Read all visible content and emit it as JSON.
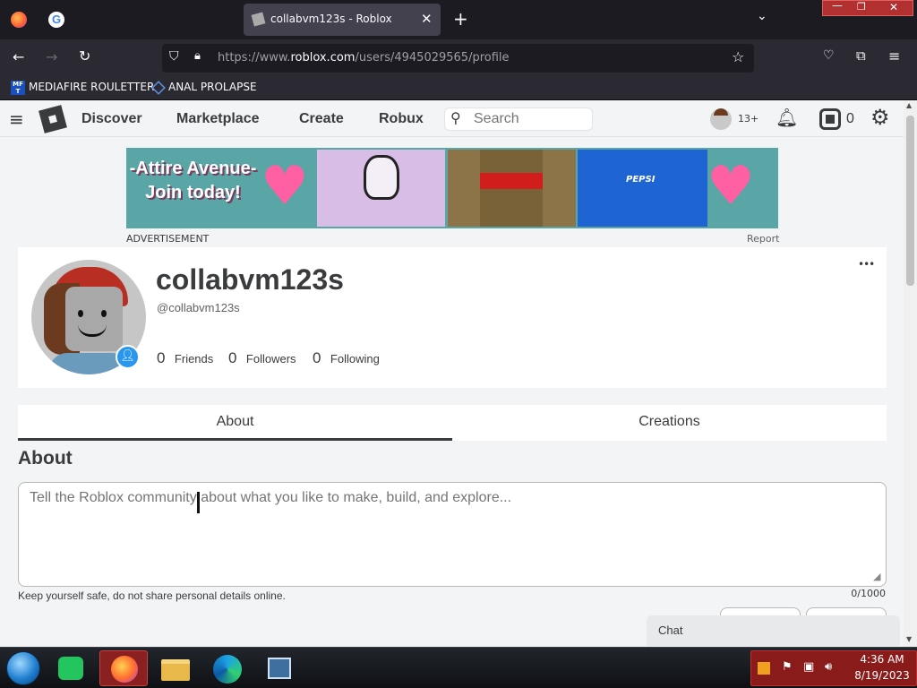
{
  "browser": {
    "tab_title": "collabvm123s - Roblox",
    "url_prefix": "https://www.",
    "url_domain": "roblox.com",
    "url_suffix": "/users/4945029565/profile",
    "bookmarks": [
      "MEDIAFIRE ROULETTER",
      "ANAL PROLAPSE"
    ]
  },
  "nav": {
    "links": [
      "Discover",
      "Marketplace",
      "Create",
      "Robux"
    ],
    "search_placeholder": "Search",
    "age_badge": "13+",
    "robux_count": "0"
  },
  "ad": {
    "headline_1": "-Attire Avenue-",
    "headline_2": "Join today!",
    "label": "ADVERTISEMENT",
    "report": "Report",
    "shirt_brand": "PEPSI"
  },
  "profile": {
    "display_name": "collabvm123s",
    "username": "@collabvm123s",
    "friends_count": "0",
    "friends_label": "Friends",
    "followers_count": "0",
    "followers_label": "Followers",
    "following_count": "0",
    "following_label": "Following",
    "more": "•••"
  },
  "tabs": [
    "About",
    "Creations"
  ],
  "about": {
    "title": "About",
    "placeholder": "Tell the Roblox community about what you like to make, build, and explore...",
    "safety_note": "Keep yourself safe, do not share personal details online.",
    "counter": "0/1000"
  },
  "chat": {
    "label": "Chat"
  },
  "taskbar": {
    "time": "4:36 AM",
    "date": "8/19/2023"
  }
}
